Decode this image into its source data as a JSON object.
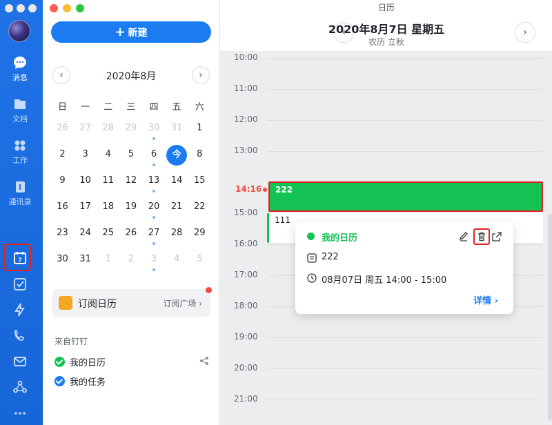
{
  "app": {
    "window_title": "日历"
  },
  "nav": {
    "items": [
      {
        "label": "消息",
        "icon": "chat-bubble-icon",
        "active": true
      },
      {
        "label": "文档",
        "icon": "documents-icon"
      },
      {
        "label": "工作",
        "icon": "apps-grid-icon"
      },
      {
        "label": "通讯录",
        "icon": "contacts-icon"
      }
    ],
    "icon_only": [
      "calendar-icon",
      "todo-check-icon",
      "lightning-icon",
      "phone-icon",
      "mail-icon",
      "network-icon",
      "more-icon"
    ]
  },
  "sidebar": {
    "new_button": "新建",
    "mini_calendar": {
      "title": "2020年8月",
      "weekdays": [
        "日",
        "一",
        "二",
        "三",
        "四",
        "五",
        "六"
      ],
      "weeks": [
        [
          {
            "d": "26",
            "m": 1
          },
          {
            "d": "27",
            "m": 1
          },
          {
            "d": "28",
            "m": 1
          },
          {
            "d": "29",
            "m": 1
          },
          {
            "d": "30",
            "m": 1,
            "dot": 1
          },
          {
            "d": "31",
            "m": 1
          },
          {
            "d": "1"
          }
        ],
        [
          {
            "d": "2"
          },
          {
            "d": "3"
          },
          {
            "d": "4"
          },
          {
            "d": "5"
          },
          {
            "d": "6",
            "dot": 1
          },
          {
            "d": "今",
            "today": 1
          },
          {
            "d": "8"
          }
        ],
        [
          {
            "d": "9"
          },
          {
            "d": "10"
          },
          {
            "d": "11"
          },
          {
            "d": "12"
          },
          {
            "d": "13",
            "dot": 1
          },
          {
            "d": "14"
          },
          {
            "d": "15"
          }
        ],
        [
          {
            "d": "16"
          },
          {
            "d": "17"
          },
          {
            "d": "18"
          },
          {
            "d": "19"
          },
          {
            "d": "20",
            "dot": 1
          },
          {
            "d": "21"
          },
          {
            "d": "22"
          }
        ],
        [
          {
            "d": "23"
          },
          {
            "d": "24"
          },
          {
            "d": "25"
          },
          {
            "d": "26"
          },
          {
            "d": "27",
            "dot": 1
          },
          {
            "d": "28"
          },
          {
            "d": "29"
          }
        ],
        [
          {
            "d": "30"
          },
          {
            "d": "31"
          },
          {
            "d": "1",
            "m": 1
          },
          {
            "d": "2",
            "m": 1
          },
          {
            "d": "3",
            "m": 1,
            "dot": 1
          },
          {
            "d": "4",
            "m": 1
          },
          {
            "d": "5",
            "m": 1
          }
        ]
      ]
    },
    "subscribe": {
      "title": "订阅日历",
      "link": "订阅广场"
    },
    "from_label": "来自钉钉",
    "calendars": [
      {
        "name": "我的日历",
        "color": "#15c355"
      },
      {
        "name": "我的任务",
        "color": "#1a7cf0"
      }
    ]
  },
  "day_view": {
    "title": "2020年8月7日 星期五",
    "subtitle": "农历 立秋",
    "hours": [
      "10:00",
      "11:00",
      "12:00",
      "13:00",
      "15:00",
      "16:00",
      "17:00",
      "18:00",
      "19:00",
      "20:00",
      "21:00"
    ],
    "now_label": "14:16",
    "events": [
      {
        "title": "222",
        "color": "#15c355"
      },
      {
        "title": "111"
      }
    ]
  },
  "popover": {
    "calendar_name": "我的日历",
    "event_title": "222",
    "time": "08月07日 周五 14:00 - 15:00",
    "detail_link": "详情"
  },
  "colors": {
    "brand_blue": "#1a7cf0",
    "event_green": "#15c355",
    "highlight_red": "#e02020"
  }
}
